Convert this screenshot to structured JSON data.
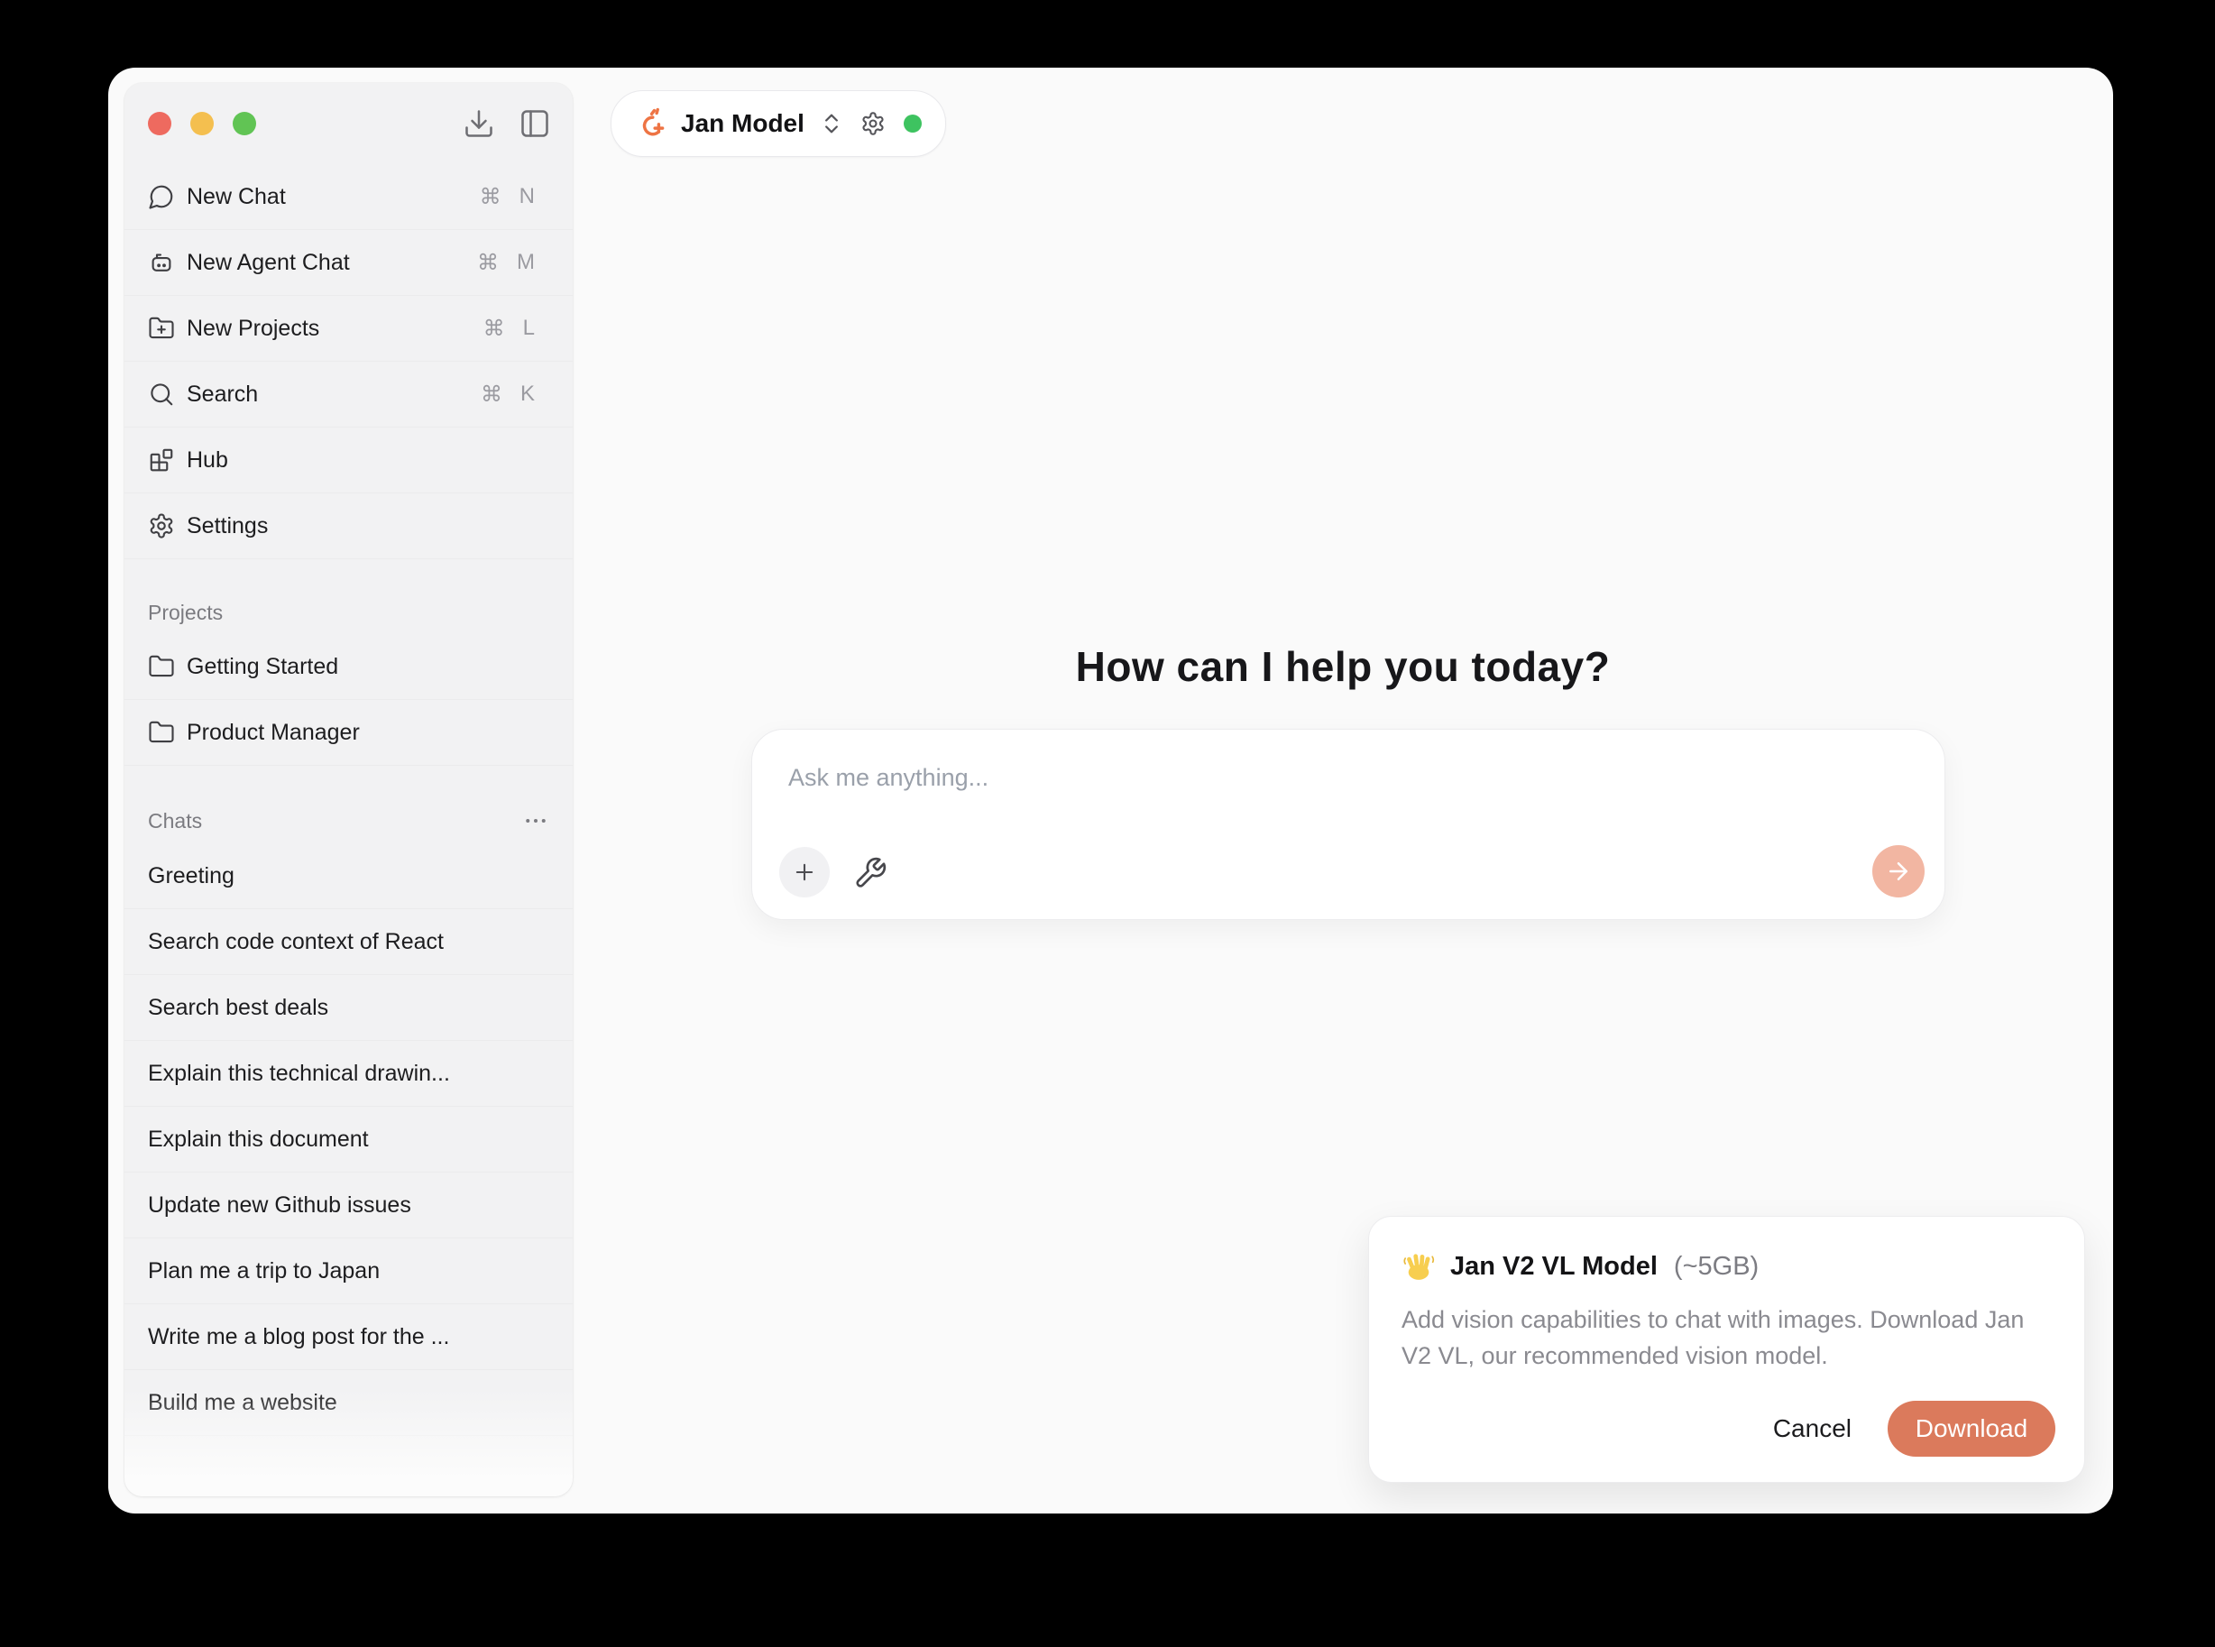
{
  "colors": {
    "accent_download": "#DB7A5C",
    "send_button_bg": "#F2B6A2",
    "status_online": "#3EC360",
    "traffic_close": "#EE6A5F",
    "traffic_minimize": "#F4BF4F",
    "traffic_zoom": "#61C454",
    "jan_logo_orange": "#EE7444",
    "sidebar_bg": "#F2F2F3",
    "window_bg": "#FAFAFA"
  },
  "window": {
    "traffic_lights": [
      "close",
      "minimize",
      "zoom"
    ],
    "toolbar_icons": [
      "download-icon",
      "panel-left-icon"
    ]
  },
  "sidebar": {
    "menu": [
      {
        "label": "New Chat",
        "icon": "chat-bubble-icon",
        "shortcut_mod": "⌘",
        "shortcut_key": "N"
      },
      {
        "label": "New Agent Chat",
        "icon": "robot-icon",
        "shortcut_mod": "⌘",
        "shortcut_key": "M"
      },
      {
        "label": "New Projects",
        "icon": "folder-plus-icon",
        "shortcut_mod": "⌘",
        "shortcut_key": "L"
      },
      {
        "label": "Search",
        "icon": "search-icon",
        "shortcut_mod": "⌘",
        "shortcut_key": "K"
      },
      {
        "label": "Hub",
        "icon": "blocks-icon"
      },
      {
        "label": "Settings",
        "icon": "gear-icon"
      }
    ],
    "projects": {
      "header": "Projects",
      "items": [
        {
          "label": "Getting Started",
          "icon": "folder-icon"
        },
        {
          "label": "Product Manager",
          "icon": "folder-icon"
        }
      ]
    },
    "chats": {
      "header": "Chats",
      "menu_icon": "ellipsis-icon",
      "items": [
        "Greeting",
        "Search code context of React",
        "Search best deals",
        "Explain this technical drawin...",
        "Explain this document",
        "Update new Github issues",
        "Plan me a trip to Japan",
        "Write me a blog post for the ...",
        "Build me a website"
      ]
    }
  },
  "header": {
    "model_selector": {
      "logo_icon": "jan-logo-icon",
      "label": "Jan Model",
      "chevron_icon": "chevrons-up-down-icon",
      "gear_icon": "gear-icon",
      "status": "online"
    }
  },
  "main": {
    "heading": "How can I help you today?",
    "composer": {
      "placeholder": "Ask me anything...",
      "buttons": [
        "plus-icon",
        "wrench-icon",
        "send-arrow-icon"
      ]
    }
  },
  "notification": {
    "emoji_icon": "waving-hand-icon",
    "title": "Jan V2 VL Model",
    "size": "(~5GB)",
    "body": "Add vision capabilities to chat with images. Download Jan V2 VL, our recommended vision model.",
    "cancel_label": "Cancel",
    "download_label": "Download"
  }
}
